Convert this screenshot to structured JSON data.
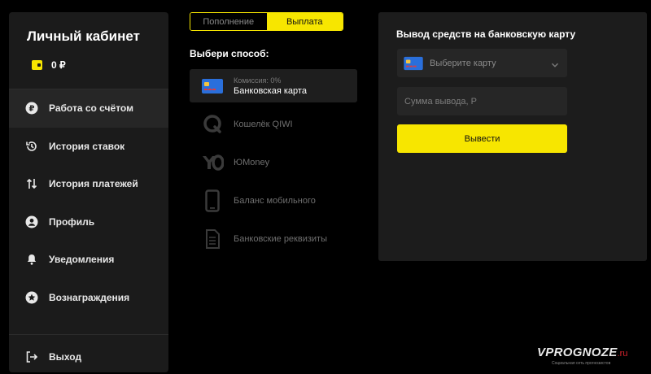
{
  "sidebar": {
    "title": "Личный кабинет",
    "balance": "0 ₽",
    "items": [
      {
        "label": "Работа со счётом",
        "icon": "ruble-icon",
        "active": true
      },
      {
        "label": "История ставок",
        "icon": "history-icon",
        "active": false
      },
      {
        "label": "История платежей",
        "icon": "transfer-arrows-icon",
        "active": false
      },
      {
        "label": "Профиль",
        "icon": "user-icon",
        "active": false
      },
      {
        "label": "Уведомления",
        "icon": "bell-icon",
        "active": false
      },
      {
        "label": "Вознаграждения",
        "icon": "star-badge-icon",
        "active": false
      }
    ],
    "logout": "Выход"
  },
  "tabs": [
    {
      "label": "Пополнение",
      "active": false
    },
    {
      "label": "Выплата",
      "active": true
    }
  ],
  "choose_label": "Выбери способ:",
  "methods": [
    {
      "hint": "Комиссия: 0%",
      "name": "Банковская карта",
      "icon": "bank-card-icon",
      "active": true
    },
    {
      "hint": "",
      "name": "Кошелёк QIWI",
      "icon": "qiwi-icon",
      "active": false
    },
    {
      "hint": "",
      "name": "ЮMoney",
      "icon": "yumoney-icon",
      "active": false
    },
    {
      "hint": "",
      "name": "Баланс мобильного",
      "icon": "mobile-phone-icon",
      "active": false
    },
    {
      "hint": "",
      "name": "Банковские реквизиты",
      "icon": "document-icon",
      "active": false
    }
  ],
  "panel": {
    "title": "Вывод средств на банковскую карту",
    "select_placeholder": "Выберите карту",
    "amount_placeholder": "Сумма вывода, Р",
    "button": "Вывести"
  },
  "watermark": {
    "main": "VPROGNOZE",
    "domain": ".ru",
    "sub": "Социальная сеть прогнозистов"
  },
  "colors": {
    "accent": "#f7e600",
    "background": "#000000",
    "panel": "#1c1c1c",
    "sidebar": "#1b1b1b"
  }
}
